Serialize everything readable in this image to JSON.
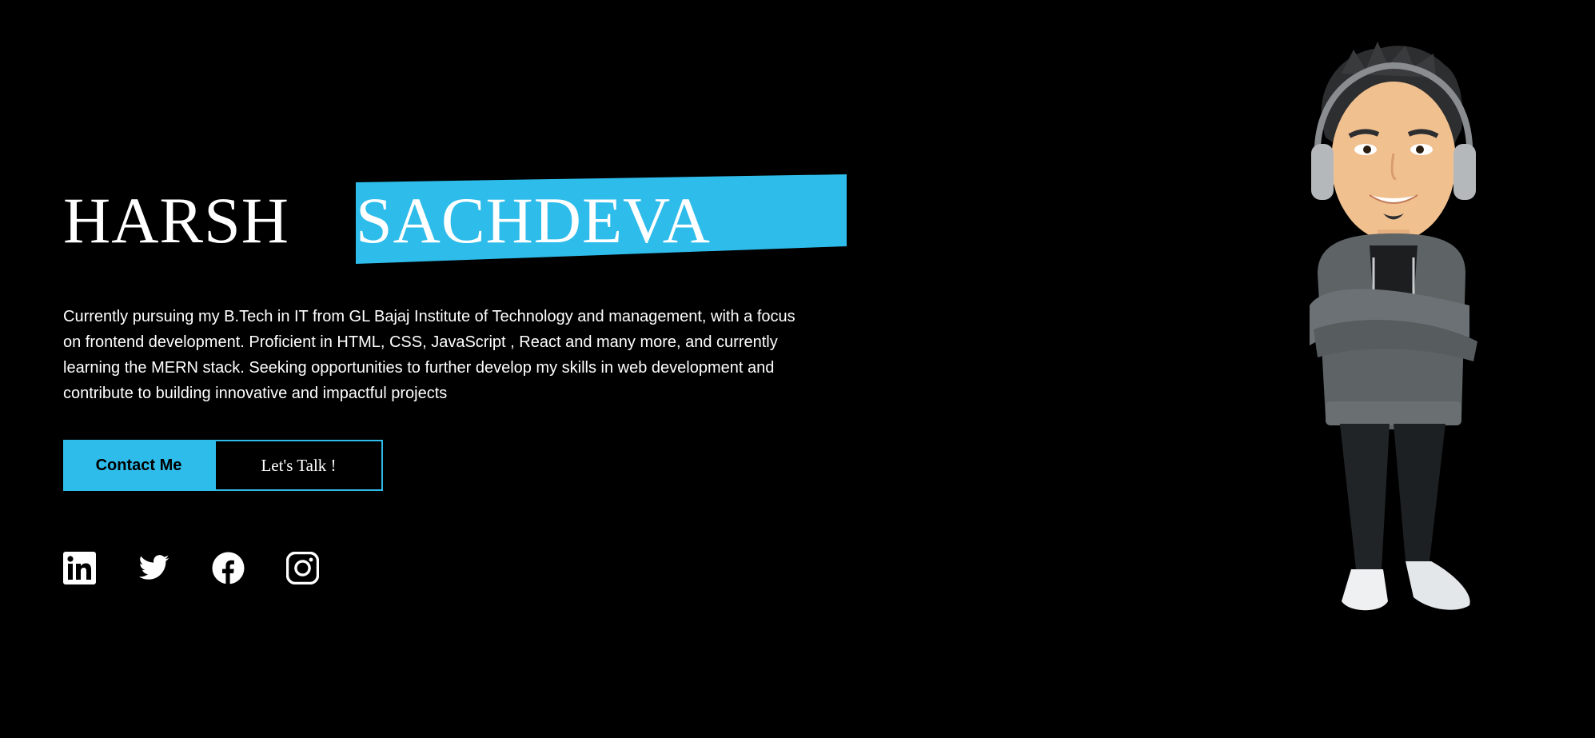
{
  "hero": {
    "first_name": "HARSH",
    "last_name": "SACHDEVA",
    "bio": "Currently pursuing my B.Tech in IT from GL Bajaj Institute of Technology and management, with a focus on frontend development. Proficient in HTML, CSS, JavaScript , React and many more, and currently learning the MERN stack. Seeking opportunities to further develop my skills in web development and contribute to building innovative and impactful projects"
  },
  "buttons": {
    "contact_label": "Contact Me",
    "talk_label": "Let's Talk !"
  },
  "socials": [
    {
      "icon": "linkedin-icon"
    },
    {
      "icon": "twitter-icon"
    },
    {
      "icon": "facebook-icon"
    },
    {
      "icon": "instagram-icon"
    }
  ],
  "colors": {
    "background": "#000000",
    "accent": "#2ebcea",
    "text": "#ffffff"
  },
  "avatar": {
    "icon": "bitmoji-avatar"
  }
}
